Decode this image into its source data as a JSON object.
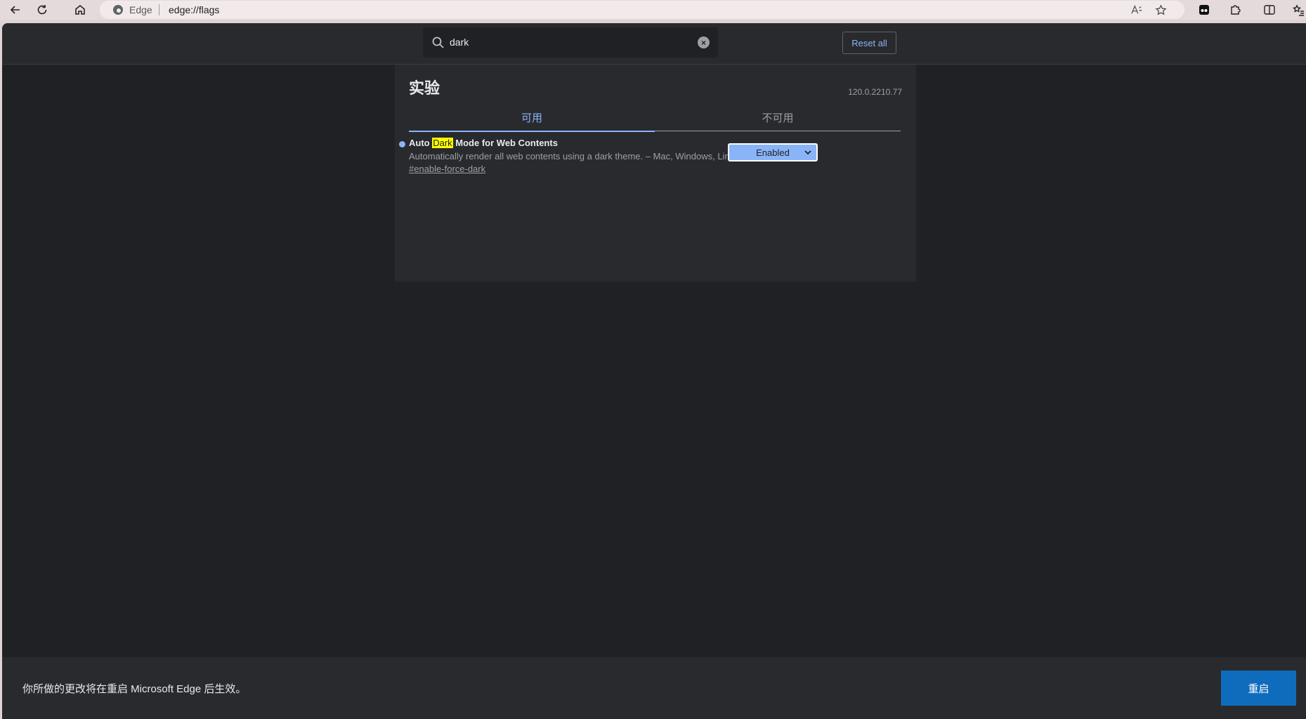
{
  "browser": {
    "site_name": "Edge",
    "url": "edge://flags"
  },
  "header": {
    "search_value": "dark",
    "reset_label": "Reset all"
  },
  "panel": {
    "title": "实验",
    "version": "120.0.2210.77",
    "tabs": [
      {
        "label": "可用",
        "active": true
      },
      {
        "label": "不可用",
        "active": false
      }
    ]
  },
  "experiments": [
    {
      "title_prefix": "Auto ",
      "title_highlight": "Dark",
      "title_suffix": " Mode for Web Contents",
      "description": "Automatically render all web contents using a dark theme. – Mac, Windows, Linux",
      "link": "#enable-force-dark",
      "selected": "Enabled"
    }
  ],
  "footer": {
    "message": "你所做的更改将在重启 Microsoft Edge 后生效。",
    "restart_label": "重启"
  },
  "colors": {
    "page_bg": "#202124",
    "panel_bg": "#292a2d",
    "accent": "#8ab4f8",
    "highlight": "#ffff00",
    "restart_button": "#0f6cbd"
  }
}
